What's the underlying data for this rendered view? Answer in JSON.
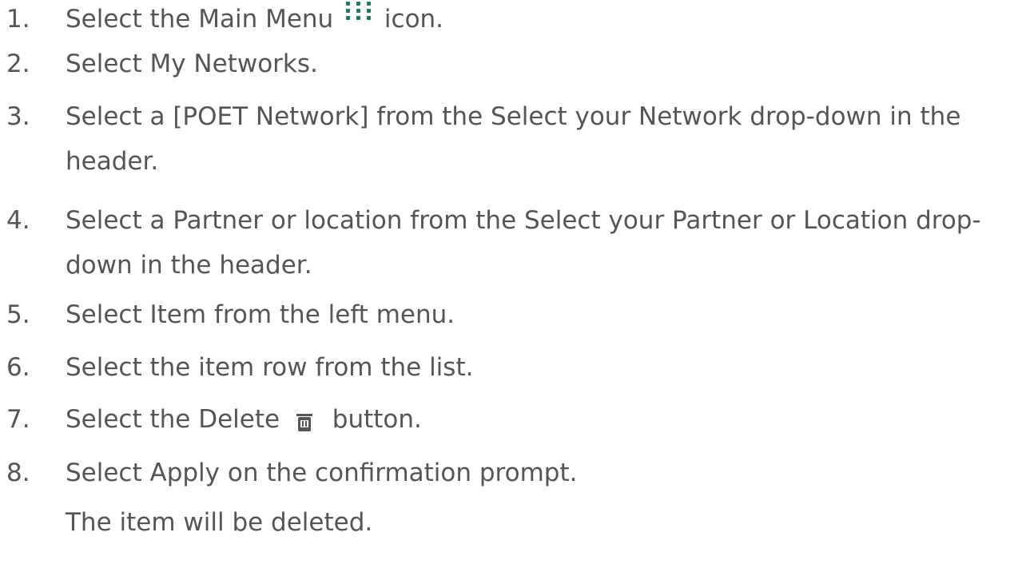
{
  "steps": [
    {
      "number": "1.",
      "before": "Select the Main Menu",
      "icon": "grid-dots-icon",
      "after": "icon."
    },
    {
      "number": "2.",
      "text": "Select My Networks."
    },
    {
      "number": "3.",
      "text": "Select a [POET Network] from the Select your Network drop-down in the header."
    },
    {
      "number": "4.",
      "text": "Select a Partner or location from the Select your Partner or Location drop-down in the header."
    },
    {
      "number": "5.",
      "text": "Select Item from the left menu."
    },
    {
      "number": "6.",
      "text": "Select the item row from the list."
    },
    {
      "number": "7.",
      "before": "Select the Delete",
      "icon": "trash-icon",
      "after": "button."
    },
    {
      "number": "8.",
      "text": "Select Apply on the confirmation prompt."
    }
  ],
  "result": "The item will be deleted.",
  "colors": {
    "text": "#555555",
    "menu_icon": "#1f7a5a",
    "trash_icon": "#555555"
  }
}
